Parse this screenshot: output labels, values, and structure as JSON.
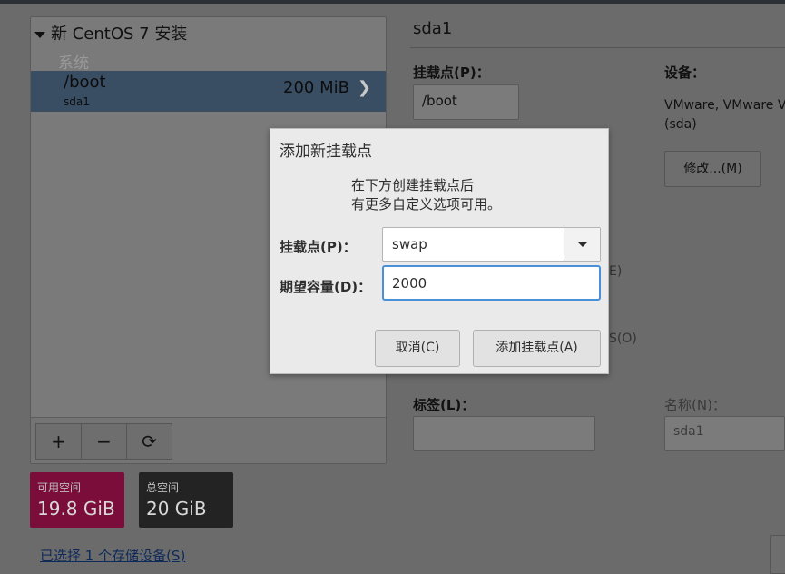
{
  "left": {
    "install_title": "新 CentOS 7 安装",
    "group_label": "系统",
    "mount": {
      "name": "/boot",
      "device": "sda1",
      "size": "200 MiB"
    },
    "toolbar": {
      "add": "+",
      "remove": "−",
      "refresh": "⟳"
    }
  },
  "space": {
    "available_label": "可用空间",
    "available_value": "19.8 GiB",
    "available_color": "#7a0d39",
    "total_label": "总空间",
    "total_value": "20 GiB"
  },
  "storage_link": "已选择 1 个存储设备(S)",
  "right": {
    "device_title": "sda1",
    "mount_point_label": "挂载点(P)：",
    "mount_point_value": "/boot",
    "device_label": "设备：",
    "device_value_line1": "VMware, VMware V",
    "device_value_line2": "(sda)",
    "modify_button": "修改...(M)",
    "partial_1": "E)",
    "partial_2": "S(O)",
    "label_label": "标签(L)：",
    "label_value": "",
    "name_label": "名称(N)：",
    "name_value": "sda1"
  },
  "dialog": {
    "title": "添加新挂载点",
    "message_line1": "在下方创建挂载点后",
    "message_line2": "有更多自定义选项可用。",
    "mount_label": "挂载点(P)：",
    "mount_value": "swap",
    "capacity_label": "期望容量(D)：",
    "capacity_value": "2000",
    "cancel_button": "取消(C)",
    "add_button": "添加挂载点(A)",
    "focus_color": "#4a90d9"
  }
}
